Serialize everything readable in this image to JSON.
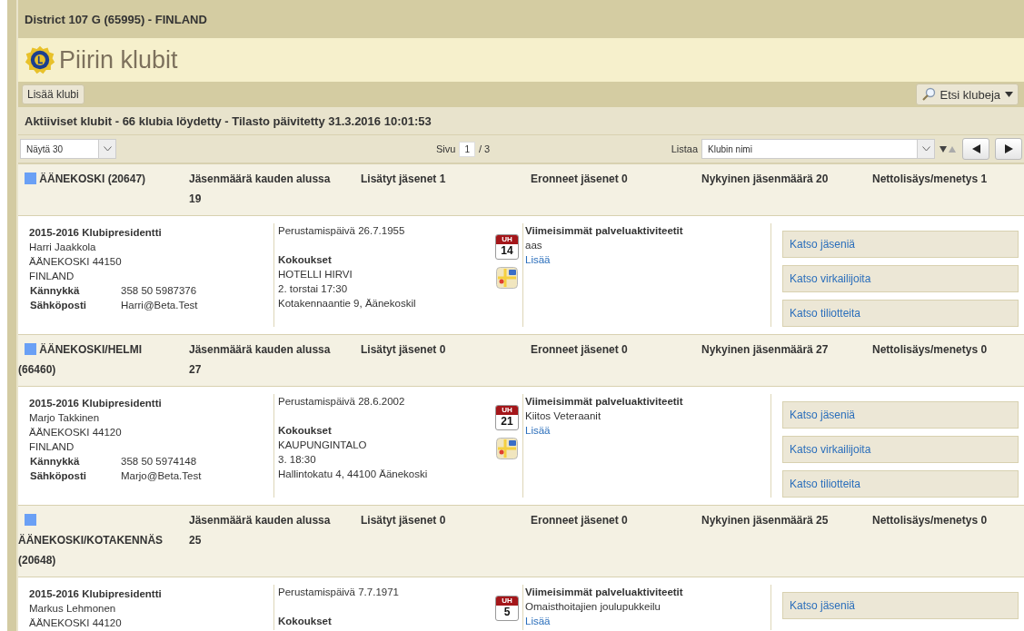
{
  "district": {
    "title": "District 107 G (65995) - FINLAND"
  },
  "page": {
    "title": "Piirin klubit"
  },
  "toolbar": {
    "add_button": "Lisää klubi",
    "search_button": "Etsi klubeja"
  },
  "status": "Aktiiviset klubit - 66 klubia löydetty - Tilasto päivitetty 31.3.2016 10:01:53",
  "pager": {
    "show_select": "Näytä 30",
    "page_label": "Sivu",
    "page_value": "1",
    "page_total": "/ 3",
    "sort_label": "Listaa",
    "sort_select": "Klubin nimi"
  },
  "clubs": [
    {
      "name": "ÄÄNEKOSKI",
      "number": "(20647)",
      "color": "#6aa0f5",
      "start_label": "Jäsenmäärä kauden alussa",
      "start_value": "19",
      "added": "Lisätyt jäsenet 1",
      "resigned": "Eronneet jäsenet 0",
      "current": "Nykyinen jäsenmäärä 20",
      "net": "Nettolisäys/menetys 1",
      "president_title": "2015-2016 Klubipresidentti",
      "president_lines": [
        "Harri Jaakkola",
        "ÄÄNEKOSKI 44150",
        "FINLAND"
      ],
      "contacts": [
        {
          "label": "Kännykkä",
          "value": "358 50 5987376"
        },
        {
          "label": "Sähköposti",
          "value": "Harri@Beta.Test"
        }
      ],
      "founded": "Perustamispäivä 26.7.1955",
      "meetings_title": "Kokoukset",
      "meetings": [
        "HOTELLI HIRVI",
        "2. torstai 17:30",
        "Kotakennaantie 9, Äänekoskil"
      ],
      "cal_month": "UH",
      "cal_day": "14",
      "map_icon": true,
      "activities_title": "Viimeisimmät palveluaktiviteetit",
      "activities": [
        "aas"
      ],
      "more_link": "Lisää",
      "actions": [
        "Katso jäseniä",
        "Katso virkailijoita",
        "Katso tiliotteita"
      ]
    },
    {
      "name": "ÄÄNEKOSKI/HELMI",
      "number": "(66460)",
      "color": "#6aa0f5",
      "start_label": "Jäsenmäärä kauden alussa",
      "start_value": "27",
      "added": "Lisätyt jäsenet 0",
      "resigned": "Eronneet jäsenet 0",
      "current": "Nykyinen jäsenmäärä 27",
      "net": "Nettolisäys/menetys 0",
      "president_title": "2015-2016 Klubipresidentti",
      "president_lines": [
        "Marjo Takkinen",
        "ÄÄNEKOSKI 44120",
        "FINLAND"
      ],
      "contacts": [
        {
          "label": "Kännykkä",
          "value": "358 50 5974148"
        },
        {
          "label": "Sähköposti",
          "value": "Marjo@Beta.Test"
        }
      ],
      "founded": "Perustamispäivä 28.6.2002",
      "meetings_title": "Kokoukset",
      "meetings": [
        "KAUPUNGINTALO",
        "3. 18:30",
        "Hallintokatu 4, 44100 Äänekoski"
      ],
      "cal_month": "UH",
      "cal_day": "21",
      "map_icon": true,
      "activities_title": "Viimeisimmät palveluaktiviteetit",
      "activities": [
        "Kiitos Veteraanit"
      ],
      "more_link": "Lisää",
      "actions": [
        "Katso jäseniä",
        "Katso virkailijoita",
        "Katso tiliotteita"
      ]
    },
    {
      "name": "ÄÄNEKOSKI/KOTAKENNÄS",
      "number": "(20648)",
      "color": "#6aa0f5",
      "start_label": "Jäsenmäärä kauden alussa",
      "start_value": "25",
      "added": "Lisätyt jäsenet 0",
      "resigned": "Eronneet jäsenet 0",
      "current": "Nykyinen jäsenmäärä 25",
      "net": "Nettolisäys/menetys 0",
      "president_title": "2015-2016 Klubipresidentti",
      "president_lines": [
        "Markus Lehmonen",
        "ÄÄNEKOSKI 44120"
      ],
      "founded": "Perustamispäivä 7.7.1971",
      "meetings_title": "Kokoukset",
      "cal_month": "UH",
      "cal_day": "5",
      "activities_title": "Viimeisimmät palveluaktiviteetit",
      "activities": [
        "Omaisthoitajien joulupukkeilu"
      ],
      "more_link": "Lisää",
      "actions": [
        "Katso jäseniä"
      ]
    }
  ]
}
